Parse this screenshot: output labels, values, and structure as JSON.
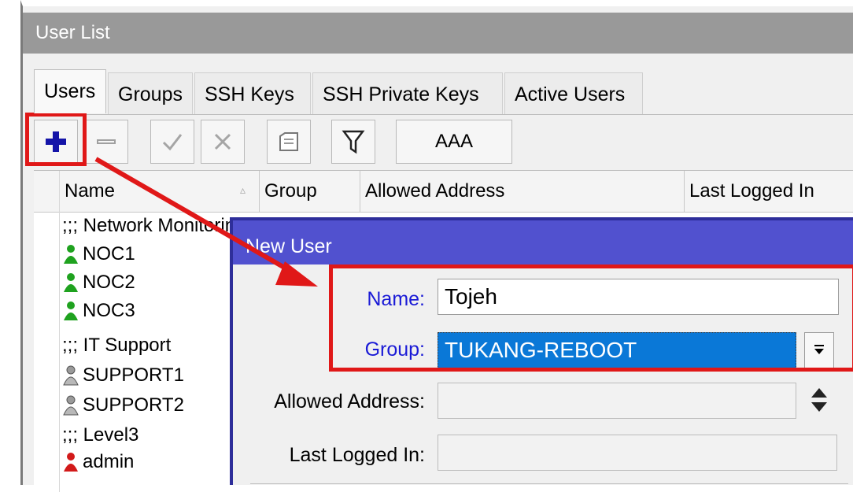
{
  "window": {
    "title": "User List"
  },
  "tabs": [
    {
      "label": "Users",
      "active": true
    },
    {
      "label": "Groups"
    },
    {
      "label": "SSH Keys"
    },
    {
      "label": "SSH Private Keys"
    },
    {
      "label": "Active Users"
    }
  ],
  "toolbar": {
    "add_icon": "plus-icon",
    "remove_icon": "minus-icon",
    "enable_icon": "check-icon",
    "disable_icon": "x-icon",
    "comment_icon": "note-icon",
    "filter_icon": "filter-icon",
    "aaa_label": "AAA"
  },
  "columns": {
    "name": "Name",
    "group": "Group",
    "allowed_address": "Allowed Address",
    "last_logged_in": "Last Logged In"
  },
  "rows": [
    {
      "type": "comment",
      "text": ";;; Network Monitoring Center"
    },
    {
      "type": "user",
      "text": "NOC1",
      "icon_color": "#1fa21f"
    },
    {
      "type": "user",
      "text": "NOC2",
      "icon_color": "#1fa21f"
    },
    {
      "type": "user",
      "text": "NOC3",
      "icon_color": "#1fa21f"
    },
    {
      "type": "comment",
      "text": ";;; IT Support"
    },
    {
      "type": "user",
      "text": "SUPPORT1",
      "icon_color": "#9a9a9a"
    },
    {
      "type": "user",
      "text": "SUPPORT2",
      "icon_color": "#9a9a9a"
    },
    {
      "type": "comment",
      "text": ";;; Level3"
    },
    {
      "type": "user",
      "text": "admin",
      "icon_color": "#d21a1a"
    }
  ],
  "dialog": {
    "title": "New User",
    "name_label": "Name:",
    "name_value": "Tojeh",
    "group_label": "Group:",
    "group_value": "TUKANG-REBOOT",
    "allowed_address_label": "Allowed Address:",
    "last_logged_in_label": "Last Logged In:"
  },
  "colors": {
    "highlight": "#e01818",
    "dialog_title": "#5151cf",
    "selection": "#0a78d7"
  }
}
